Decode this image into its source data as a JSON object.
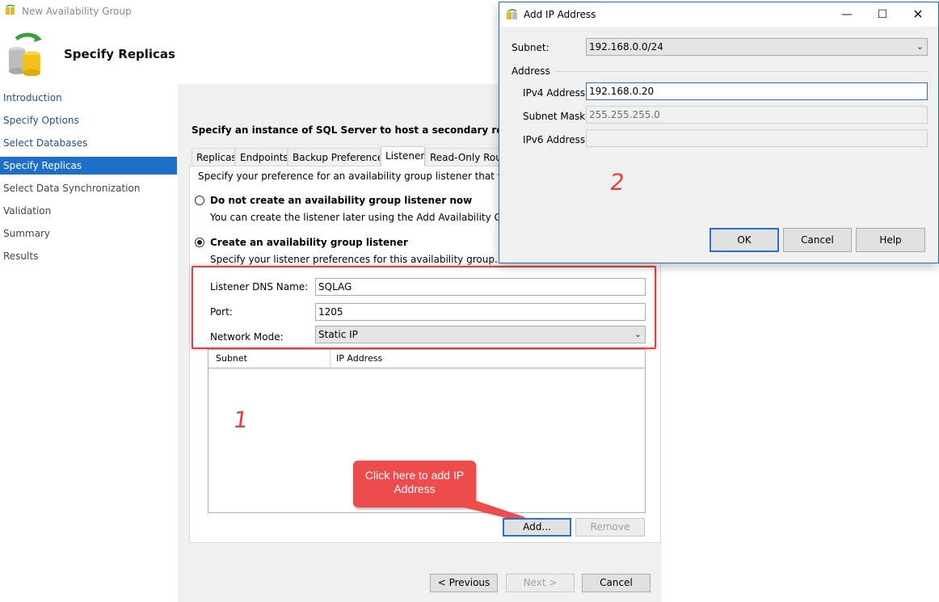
{
  "wizard": {
    "window_title": "New Availability Group",
    "header_title": "Specify Replicas",
    "nav": [
      {
        "label": "Introduction",
        "state": "link"
      },
      {
        "label": "Specify Options",
        "state": "link"
      },
      {
        "label": "Select Databases",
        "state": "link"
      },
      {
        "label": "Specify Replicas",
        "state": "selected"
      },
      {
        "label": "Select Data Synchronization",
        "state": "disabled"
      },
      {
        "label": "Validation",
        "state": "disabled"
      },
      {
        "label": "Summary",
        "state": "disabled"
      },
      {
        "label": "Results",
        "state": "disabled"
      }
    ],
    "instruction": "Specify an instance of SQL Server to host a secondary replica.",
    "tabs": [
      {
        "label": "Replicas",
        "active": false
      },
      {
        "label": "Endpoints",
        "active": false
      },
      {
        "label": "Backup Preferences",
        "active": false
      },
      {
        "label": "Listener",
        "active": true
      },
      {
        "label": "Read-Only Routi",
        "active": false
      }
    ],
    "listener": {
      "preference_text": "Specify your preference for an availability group listener that will provic",
      "option_none_label": "Do not create an availability group listener now",
      "option_none_desc": "You can create the listener later using the Add Availability Group List",
      "option_create_label": "Create an availability group listener",
      "option_create_desc": "Specify your listener preferences for this availability group.",
      "selected_option": "create",
      "dns_label": "Listener DNS Name:",
      "dns_value": "SQLAG",
      "port_label": "Port:",
      "port_value": "1205",
      "mode_label": "Network Mode:",
      "mode_value": "Static IP",
      "grid_headers": [
        "Subnet",
        "IP Address"
      ],
      "add_button": "Add...",
      "remove_button": "Remove"
    },
    "footer": {
      "previous": "< Previous",
      "next": "Next >",
      "cancel": "Cancel"
    }
  },
  "annotations": {
    "marker1": "1",
    "marker2": "2",
    "callout": "Click here to add IP Address",
    "accent_color": "#e04141"
  },
  "dialog": {
    "title": "Add IP Address",
    "subnet_label": "Subnet:",
    "subnet_value": "192.168.0.0/24",
    "address_group": "Address",
    "ipv4_label": "IPv4 Address:",
    "ipv4_value": "192.168.0.20",
    "mask_label": "Subnet Mask",
    "mask_value": "255.255.255.0",
    "ipv6_label": "IPv6 Address",
    "ipv6_value": "",
    "ok": "OK",
    "cancel": "Cancel",
    "help": "Help"
  }
}
